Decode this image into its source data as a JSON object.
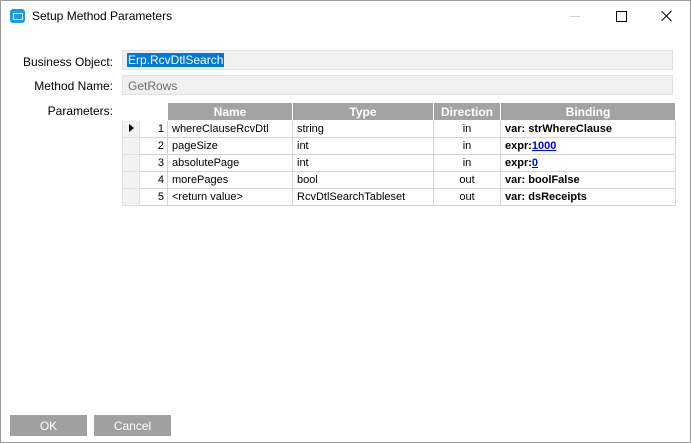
{
  "window": {
    "title": "Setup Method Parameters",
    "icon": "app-window-icon"
  },
  "form": {
    "business_object_label": "Business Object:",
    "business_object_value": "Erp.RcvDtlSearch",
    "method_name_label": "Method Name:",
    "method_name_value": "GetRows",
    "parameters_label": "Parameters:"
  },
  "grid": {
    "columns": [
      "Name",
      "Type",
      "Direction",
      "Binding"
    ],
    "rows": [
      {
        "num": "1",
        "name": "whereClauseRcvDtl",
        "type": "string",
        "direction": "in",
        "binding_prefix": "var: strWhereClause",
        "binding_link": "",
        "selected": true
      },
      {
        "num": "2",
        "name": "pageSize",
        "type": "int",
        "direction": "in",
        "binding_prefix": "expr:",
        "binding_link": "1000",
        "selected": false
      },
      {
        "num": "3",
        "name": "absolutePage",
        "type": "int",
        "direction": "in",
        "binding_prefix": "expr:",
        "binding_link": "0",
        "selected": false
      },
      {
        "num": "4",
        "name": "morePages",
        "type": "bool",
        "direction": "out",
        "binding_prefix": "var: boolFalse",
        "binding_link": "",
        "selected": false
      },
      {
        "num": "5",
        "name": "<return value>",
        "type": "RcvDtlSearchTableset",
        "direction": "out",
        "binding_prefix": "var: dsReceipts",
        "binding_link": "",
        "selected": false
      }
    ]
  },
  "buttons": {
    "ok": "OK",
    "cancel": "Cancel"
  },
  "colors": {
    "header_bg": "#a3a3a3",
    "button_bg": "#a0a0a0",
    "selection": "#0078d7",
    "icon": "#1e9ce0"
  }
}
